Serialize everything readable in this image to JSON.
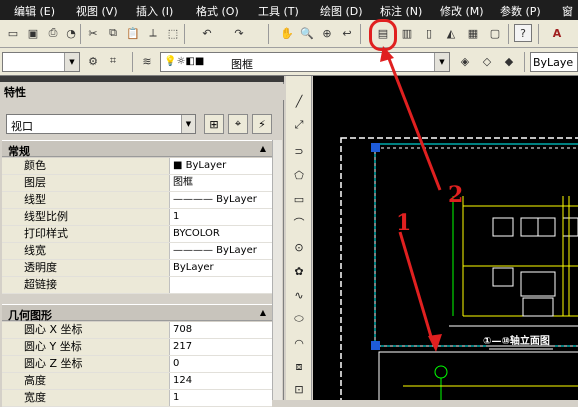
{
  "menu": {
    "items": [
      "编辑 (E)",
      "视图 (V)",
      "插入 (I)",
      "格式 (O)",
      "工具 (T)",
      "绘图 (D)",
      "标注 (N)",
      "修改 (M)",
      "参数 (P)",
      "窗"
    ]
  },
  "toolbar2": {
    "workspace_value": "",
    "layer_value": "图框",
    "linetype_value": "ByLaye"
  },
  "properties": {
    "title": "特性",
    "object_type": "视口",
    "general_section": "常规",
    "general_rows": [
      {
        "key": "颜色",
        "value": "■ ByLayer"
      },
      {
        "key": "图层",
        "value": "图框"
      },
      {
        "key": "线型",
        "value": "———— ByLayer"
      },
      {
        "key": "线型比例",
        "value": "1"
      },
      {
        "key": "打印样式",
        "value": "BYCOLOR"
      },
      {
        "key": "线宽",
        "value": "———— ByLayer"
      },
      {
        "key": "透明度",
        "value": "ByLayer"
      },
      {
        "key": "超链接",
        "value": ""
      }
    ],
    "geometry_section": "几何图形",
    "geometry_rows": [
      {
        "key": "圆心 X 坐标",
        "value": "708"
      },
      {
        "key": "圆心 Y 坐标",
        "value": "217"
      },
      {
        "key": "圆心 Z 坐标",
        "value": "0"
      },
      {
        "key": "高度",
        "value": "124"
      },
      {
        "key": "宽度",
        "value": "1"
      }
    ]
  },
  "drawing": {
    "caption": "①—⑩轴立面图"
  },
  "annotations": {
    "step1": "1",
    "step2": "2"
  },
  "colors": {
    "annotation_red": "#e02020",
    "viewport_cyan": "#00ffff",
    "grip_blue": "#1e5bd8",
    "drawing_yellow": "#ffff00",
    "drawing_green": "#00ff00"
  }
}
